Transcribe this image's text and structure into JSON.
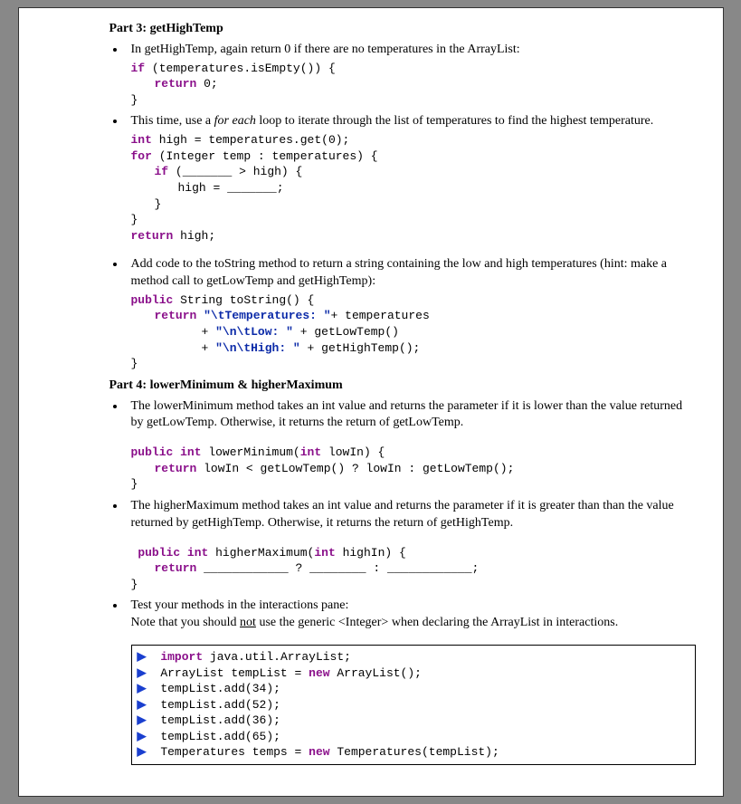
{
  "part3": {
    "title": "Part 3: getHighTemp",
    "bullet1": "In getHighTemp, again return 0 if there are no temperatures in the ArrayList:",
    "code1": {
      "l1a": "if",
      "l1b": " (temperatures.isEmpty()) {",
      "l2a": "return",
      "l2b": " 0;",
      "l3": "}"
    },
    "bullet2a": "This time, use a ",
    "bullet2em": "for each",
    "bullet2b": " loop to iterate through the list of temperatures to find the highest temperature.",
    "code2": {
      "l1a": "int",
      "l1b": " high = temperatures.get(0);",
      "l2a": "for",
      "l2b": " (Integer temp : temperatures) {",
      "l3a": "if",
      "l3b": " (_______ > high) {",
      "l4": "high = _______;",
      "l5": "}",
      "l6": "}",
      "l7a": "return",
      "l7b": " high;"
    },
    "bullet3": "Add code to the toString method to return a string containing the low and high temperatures (hint: make a method call to getLowTemp and getHighTemp):",
    "code3": {
      "l1a": "public",
      "l1b": " String toString() {",
      "l2a": "return ",
      "l2s1": "\"\\tTemperatures: \"",
      "l2b": "+ temperatures",
      "l3a": "+ ",
      "l3s": "\"\\n\\tLow: \"",
      "l3b": " + getLowTemp()",
      "l4a": "+ ",
      "l4s": "\"\\n\\tHigh: \"",
      "l4b": " + getHighTemp();",
      "l5": "}"
    }
  },
  "part4": {
    "title": "Part 4: lowerMinimum & higherMaximum",
    "bullet1": "The lowerMinimum method takes an int value and returns the parameter if it is lower than the value returned by getLowTemp. Otherwise, it returns the return of getLowTemp.",
    "code1": {
      "l1a": "public int",
      "l1b": " lowerMinimum(",
      "l1c": "int",
      "l1d": " lowIn) {",
      "l2a": "return",
      "l2b": " lowIn < getLowTemp() ? lowIn : getLowTemp();",
      "l3": "}"
    },
    "bullet2": "The higherMaximum method takes an int value and returns the parameter if it is greater than than the value returned by getHighTemp. Otherwise, it returns the return of getHighTemp.",
    "code2": {
      "l1a": "public int",
      "l1b": " higherMaximum(",
      "l1c": "int",
      "l1d": " highIn) {",
      "l2a": "return",
      "l2b": " ____________ ? ________ : ____________;",
      "l3": "}"
    },
    "bullet3a": "Test your methods in the interactions pane:",
    "bullet3b_pre": "Note that you should ",
    "bullet3b_u": "not",
    "bullet3b_post": " use the generic <Integer> when declaring the ArrayList in interactions.",
    "box": {
      "r1a": "import",
      "r1b": " java.util.ArrayList;",
      "r2a": "ArrayList tempList = ",
      "r2b": "new",
      "r2c": " ArrayList();",
      "r3": "tempList.add(34);",
      "r4": "tempList.add(52);",
      "r5": "tempList.add(36);",
      "r6": "tempList.add(65);",
      "r7a": "Temperatures temps = ",
      "r7b": "new",
      "r7c": " Temperatures(tempList);"
    },
    "arrow": "▶"
  }
}
